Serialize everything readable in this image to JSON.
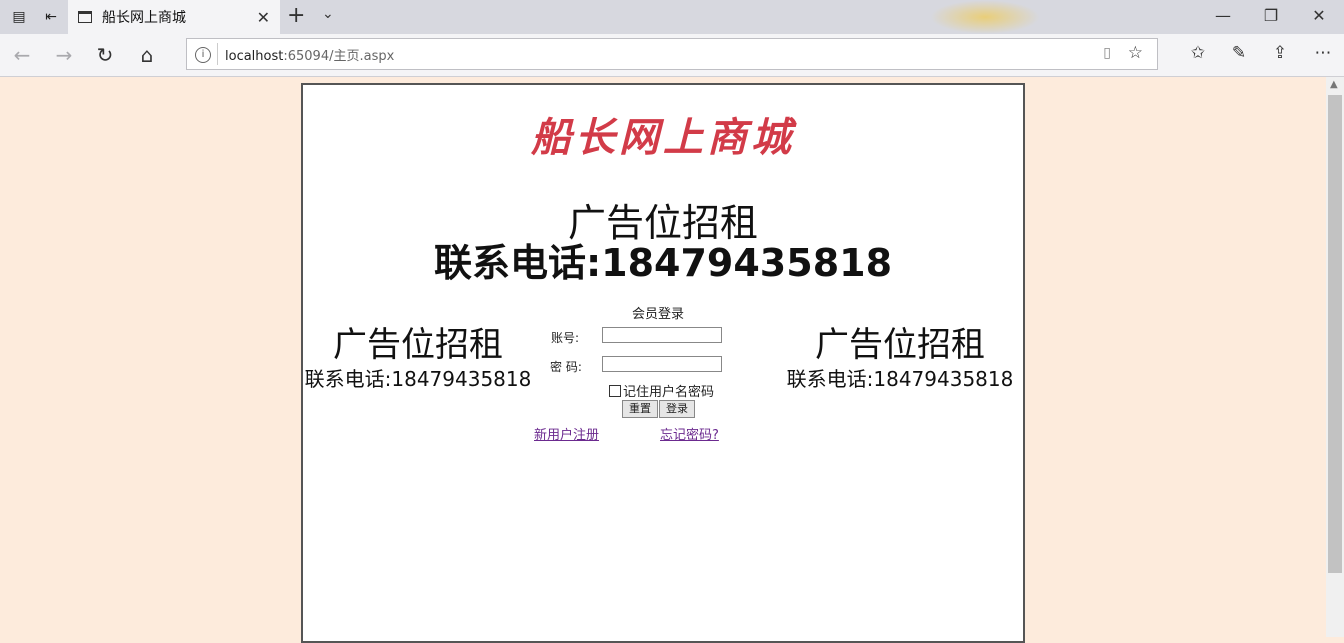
{
  "browser": {
    "tab_title": "船长网上商城",
    "url_host": "localhost",
    "url_rest": ":65094/主页.aspx"
  },
  "page": {
    "logo": "船长网上商城",
    "banner_line1": "广告位招租",
    "banner_line2": "联系电话:18479435818",
    "left_ad_line1": "广告位招租",
    "left_ad_line2": "联系电话:18479435818",
    "right_ad_line1": "广告位招租",
    "right_ad_line2": "联系电话:18479435818",
    "login": {
      "title": "会员登录",
      "account_label": "账号:",
      "password_label": "密 码:",
      "account_value": "",
      "password_value": "",
      "remember_label": "记住用户名密码",
      "reset_label": "重置",
      "login_label": "登录"
    },
    "register_link": "新用户注册",
    "forgot_link": "忘记密码?"
  }
}
